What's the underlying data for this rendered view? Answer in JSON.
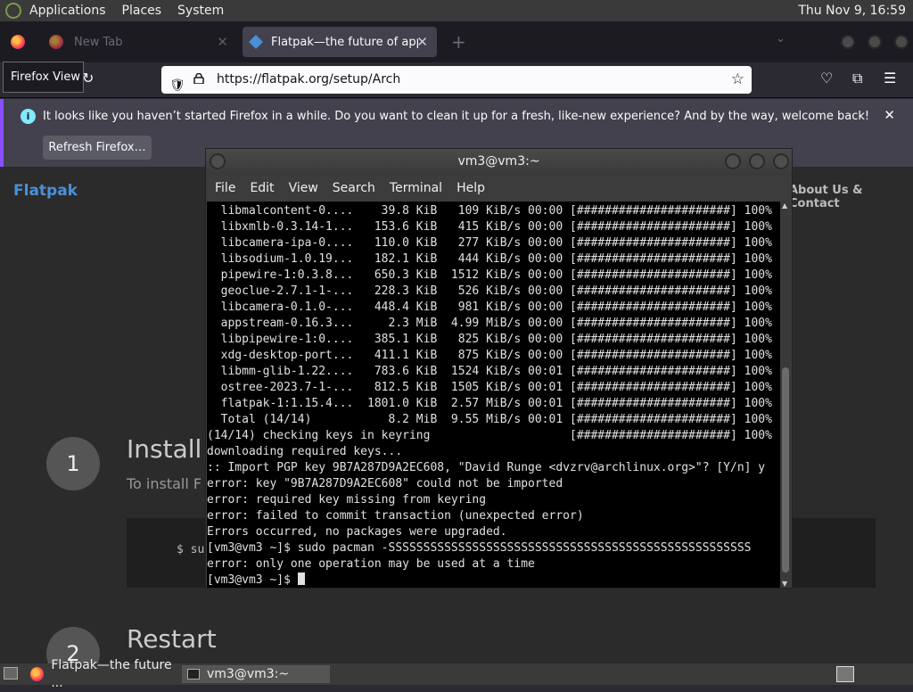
{
  "top_panel": {
    "menus": [
      "Applications",
      "Places",
      "System"
    ],
    "clock": "Thu Nov  9, 16:59"
  },
  "firefox": {
    "tabs": [
      {
        "title": "New Tab"
      },
      {
        "title": "Flatpak—the future of appli"
      }
    ],
    "tooltip": "Firefox View",
    "url": "https://flatpak.org/setup/Arch",
    "notification": {
      "message": "It looks like you haven’t started Firefox in a while. Do you want to clean it up for a fresh, like-new experience? And by the way, welcome back!",
      "button": "Refresh Firefox…"
    }
  },
  "page": {
    "brand": "Flatpak",
    "nav_about": "About Us & Contact",
    "step1_num": "1",
    "step1_title": "Install",
    "step1_sub": "To install F",
    "code": "$ su",
    "step2_num": "2",
    "step2_title": "Restart"
  },
  "terminal": {
    "title": "vm3@vm3:~",
    "menus": [
      "File",
      "Edit",
      "View",
      "Search",
      "Terminal",
      "Help"
    ],
    "lines": [
      "  libmalcontent-0....    39.8 KiB   109 KiB/s 00:00 [######################] 100%",
      "  libxmlb-0.3.14-1...   153.6 KiB   415 KiB/s 00:00 [######################] 100%",
      "  libcamera-ipa-0....   110.0 KiB   277 KiB/s 00:00 [######################] 100%",
      "  libsodium-1.0.19...   182.1 KiB   444 KiB/s 00:00 [######################] 100%",
      "  pipewire-1:0.3.8...   650.3 KiB  1512 KiB/s 00:00 [######################] 100%",
      "  geoclue-2.7.1-1-...   228.3 KiB   526 KiB/s 00:00 [######################] 100%",
      "  libcamera-0.1.0-...   448.4 KiB   981 KiB/s 00:00 [######################] 100%",
      "  appstream-0.16.3...     2.3 MiB  4.99 MiB/s 00:00 [######################] 100%",
      "  libpipewire-1:0....   385.1 KiB   825 KiB/s 00:00 [######################] 100%",
      "  xdg-desktop-port...   411.1 KiB   875 KiB/s 00:00 [######################] 100%",
      "  libmm-glib-1.22....   783.6 KiB  1524 KiB/s 00:01 [######################] 100%",
      "  ostree-2023.7-1-...   812.5 KiB  1505 KiB/s 00:01 [######################] 100%",
      "  flatpak-1:1.15.4...  1801.0 KiB  2.57 MiB/s 00:01 [######################] 100%",
      "  Total (14/14)           8.2 MiB  9.55 MiB/s 00:01 [######################] 100%",
      "(14/14) checking keys in keyring                    [######################] 100%",
      "downloading required keys...",
      ":: Import PGP key 9B7A287D9A2EC608, \"David Runge <dvzrv@archlinux.org>\"? [Y/n] y",
      "error: key \"9B7A287D9A2EC608\" could not be imported",
      "error: required key missing from keyring",
      "error: failed to commit transaction (unexpected error)",
      "Errors occurred, no packages were upgraded.",
      "[vm3@vm3 ~]$ sudo pacman -SSSSSSSSSSSSSSSSSSSSSSSSSSSSSSSSSSSSSSSSSSSSSSSSSSSS",
      "error: only one operation may be used at a time"
    ],
    "prompt": "[vm3@vm3 ~]$ "
  },
  "taskbar": {
    "items": [
      "Flatpak—the future ...",
      "vm3@vm3:~"
    ]
  }
}
